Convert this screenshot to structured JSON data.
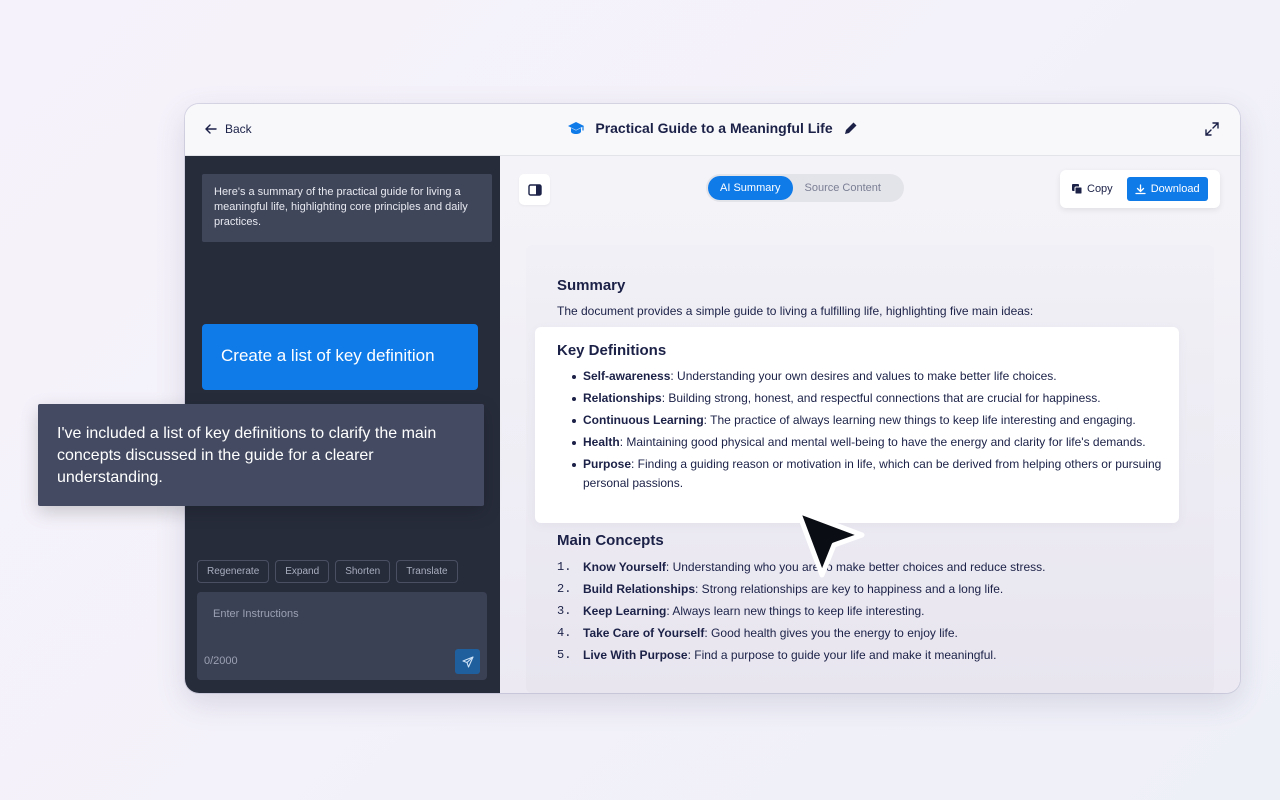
{
  "header": {
    "back_label": "Back",
    "title": "Practical Guide to a Meaningful Life"
  },
  "sidebar": {
    "ai_message": "Here's a summary of the practical guide for living a meaningful life, highlighting core principles and daily practices.",
    "user_message": "Create a list of key definition",
    "actions": [
      "Regenerate",
      "Expand",
      "Shorten",
      "Translate"
    ],
    "input_placeholder": "Enter Instructions",
    "char_counter": "0/2000"
  },
  "tooltip": {
    "text": "I've included a list of key definitions to clarify the main concepts discussed in the guide for a clearer understanding."
  },
  "tabs": [
    {
      "label": "AI Summary",
      "active": true
    },
    {
      "label": "Source Content",
      "active": false
    }
  ],
  "toolbar": {
    "copy_label": "Copy",
    "download_label": "Download"
  },
  "document": {
    "summary_heading": "Summary",
    "summary_text": "The document provides a simple guide to living a fulfilling life, highlighting five main ideas:",
    "key_definitions_heading": "Key Definitions",
    "key_definitions": [
      {
        "term": "Self-awareness",
        "text": ": Understanding your own desires and values to make better life choices."
      },
      {
        "term": "Relationships",
        "text": ": Building strong, honest, and respectful connections that are crucial for happiness."
      },
      {
        "term": "Continuous Learning",
        "text": ": The practice of always learning new things to keep life interesting and engaging."
      },
      {
        "term": "Health",
        "text": ": Maintaining good physical and mental well-being to have the energy and clarity for life's demands."
      },
      {
        "term": "Purpose",
        "text": ": Finding a guiding reason or motivation in life, which can be derived from helping others or pursuing personal passions."
      }
    ],
    "main_concepts_heading": "Main Concepts",
    "main_concepts": [
      {
        "num": "1.",
        "term": "Know Yourself",
        "text": ": Understanding who you are to make better choices and reduce stress."
      },
      {
        "num": "2.",
        "term": "Build Relationships",
        "text": ": Strong relationships are key to happiness and a long life."
      },
      {
        "num": "3.",
        "term": "Keep Learning",
        "text": ": Always learn new things to keep life interesting."
      },
      {
        "num": "4.",
        "term": "Take Care of Yourself",
        "text": ": Good health gives you the energy to enjoy life."
      },
      {
        "num": "5.",
        "term": "Live With Purpose",
        "text": ": Find a purpose to guide your life and make it meaningful."
      }
    ]
  },
  "colors": {
    "accent": "#0f7be9",
    "sidebar_bg": "#272c3b",
    "text_dark": "#1b2147"
  },
  "icons": {
    "back": "arrow-left-icon",
    "title": "graduation-cap-icon",
    "edit": "pencil-icon",
    "expand": "expand-icon",
    "panel": "panel-toggle-icon",
    "copy": "copy-icon",
    "download": "download-icon",
    "send": "send-icon",
    "cursor": "mouse-pointer-icon"
  }
}
